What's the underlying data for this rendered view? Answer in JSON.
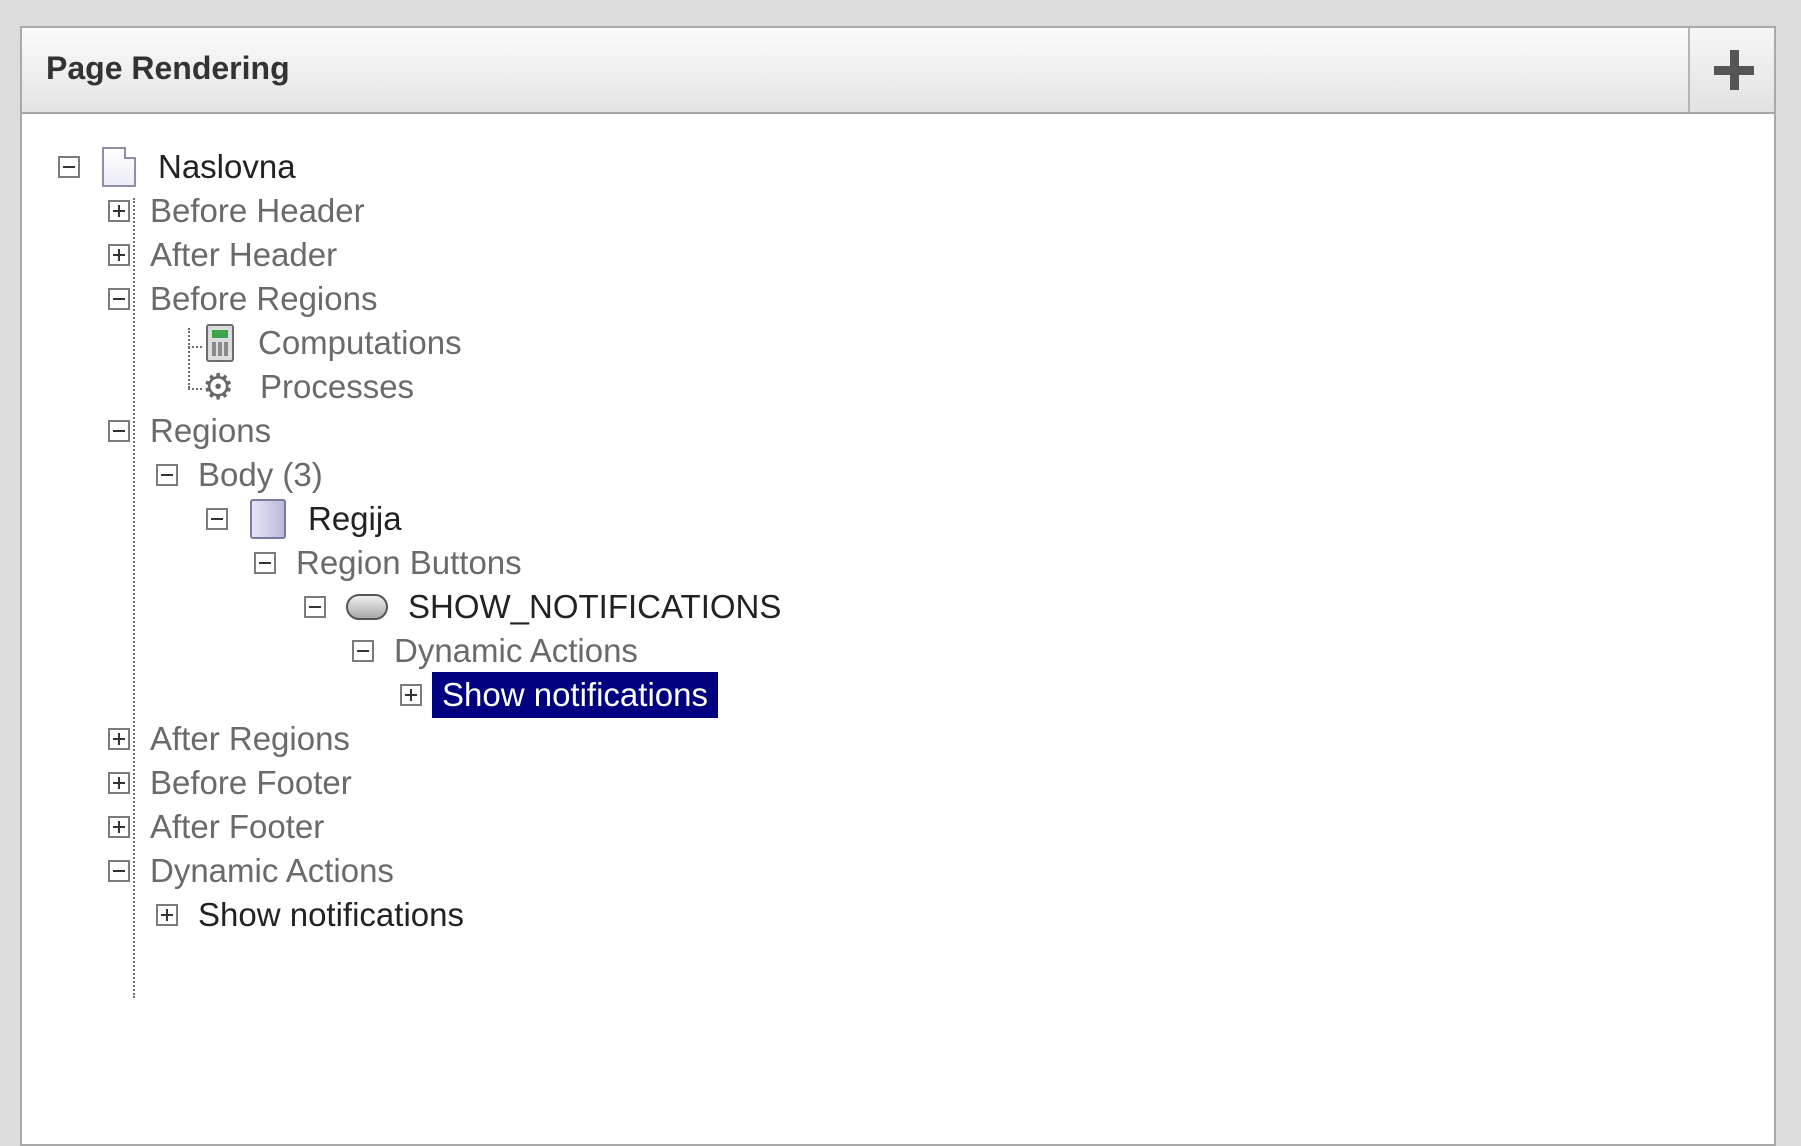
{
  "panel": {
    "title": "Page Rendering",
    "add_label": "+"
  },
  "tree": {
    "root": "Naslovna",
    "before_header": "Before Header",
    "after_header": "After Header",
    "before_regions": "Before Regions",
    "computations": "Computations",
    "processes": "Processes",
    "regions": "Regions",
    "body": "Body (3)",
    "regija": "Regija",
    "region_buttons": "Region Buttons",
    "show_notifications_button": "SHOW_NOTIFICATIONS",
    "dynamic_actions_inner": "Dynamic Actions",
    "show_notifications_selected": "Show notifications",
    "after_regions": "After Regions",
    "before_footer": "Before Footer",
    "after_footer": "After Footer",
    "dynamic_actions": "Dynamic Actions",
    "show_notifications_da": "Show notifications"
  },
  "colors": {
    "selected_bg": "#000080",
    "selected_text": "#ffffff",
    "muted_text": "#6a6a6a",
    "dark_text": "#222222"
  }
}
